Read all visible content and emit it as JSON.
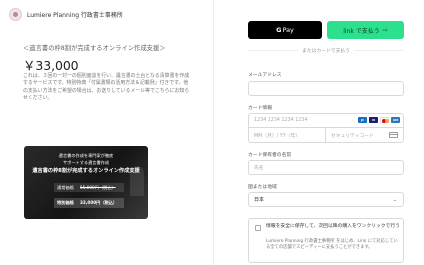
{
  "merchant": {
    "name": "Lumiere Planning 行政書士事務所"
  },
  "product": {
    "name": "＜遺言書の枠8割が完成するオンライン作成支援＞",
    "price": "￥33,000",
    "description": "これは、３回の一対一の個別面談を行い、遺言書の土台となる清算書を作成するサービスです。特別特典「付属書類の活用方法＆記載例」付きです。他の支払い方法をご希望の場合は、お送りしているメール等でこちらにお知らせください。"
  },
  "promo": {
    "line1": "遺言書の作成を専門家が徹底",
    "line2": "サポートする遺言書作成",
    "line3": "遺言書の枠8割が完成するオンライン作成支援",
    "regular_label": "通常価格",
    "regular_price": "55,000円（税込）",
    "special_label": "特別価格",
    "special_price": "33,000円（税込）"
  },
  "wallet": {
    "gpay_g": "G",
    "gpay_label": "Pay",
    "link_label": "link で支払う",
    "link_arrow": "⇨"
  },
  "separator": "またはカードで支払う",
  "form": {
    "email_label": "メールアドレス",
    "email_placeholder": "",
    "card_label": "カード情報",
    "card_number_placeholder": "1234 1234 1234 1234",
    "card_expiry_placeholder": "MM（月）/ YY（年）",
    "card_cvc_placeholder": "セキュリティコード",
    "card_brands": [
      "JCB",
      "VISA",
      "MC",
      "AMEX"
    ],
    "holder_label": "カード保有者の名前",
    "holder_placeholder": "氏名",
    "country_label": "国または地域",
    "country_value": "日本",
    "save_title": "情報を安全に保存して、次回以降の購入をワンクリックで行う",
    "save_description": "Lumiere Planning 行政書士事務所 をはじめ、Link にて対応している全ての店舗でスピーディーに支払うことができます。"
  },
  "colors": {
    "link_green": "#2de08e",
    "gpay_black": "#000000"
  }
}
